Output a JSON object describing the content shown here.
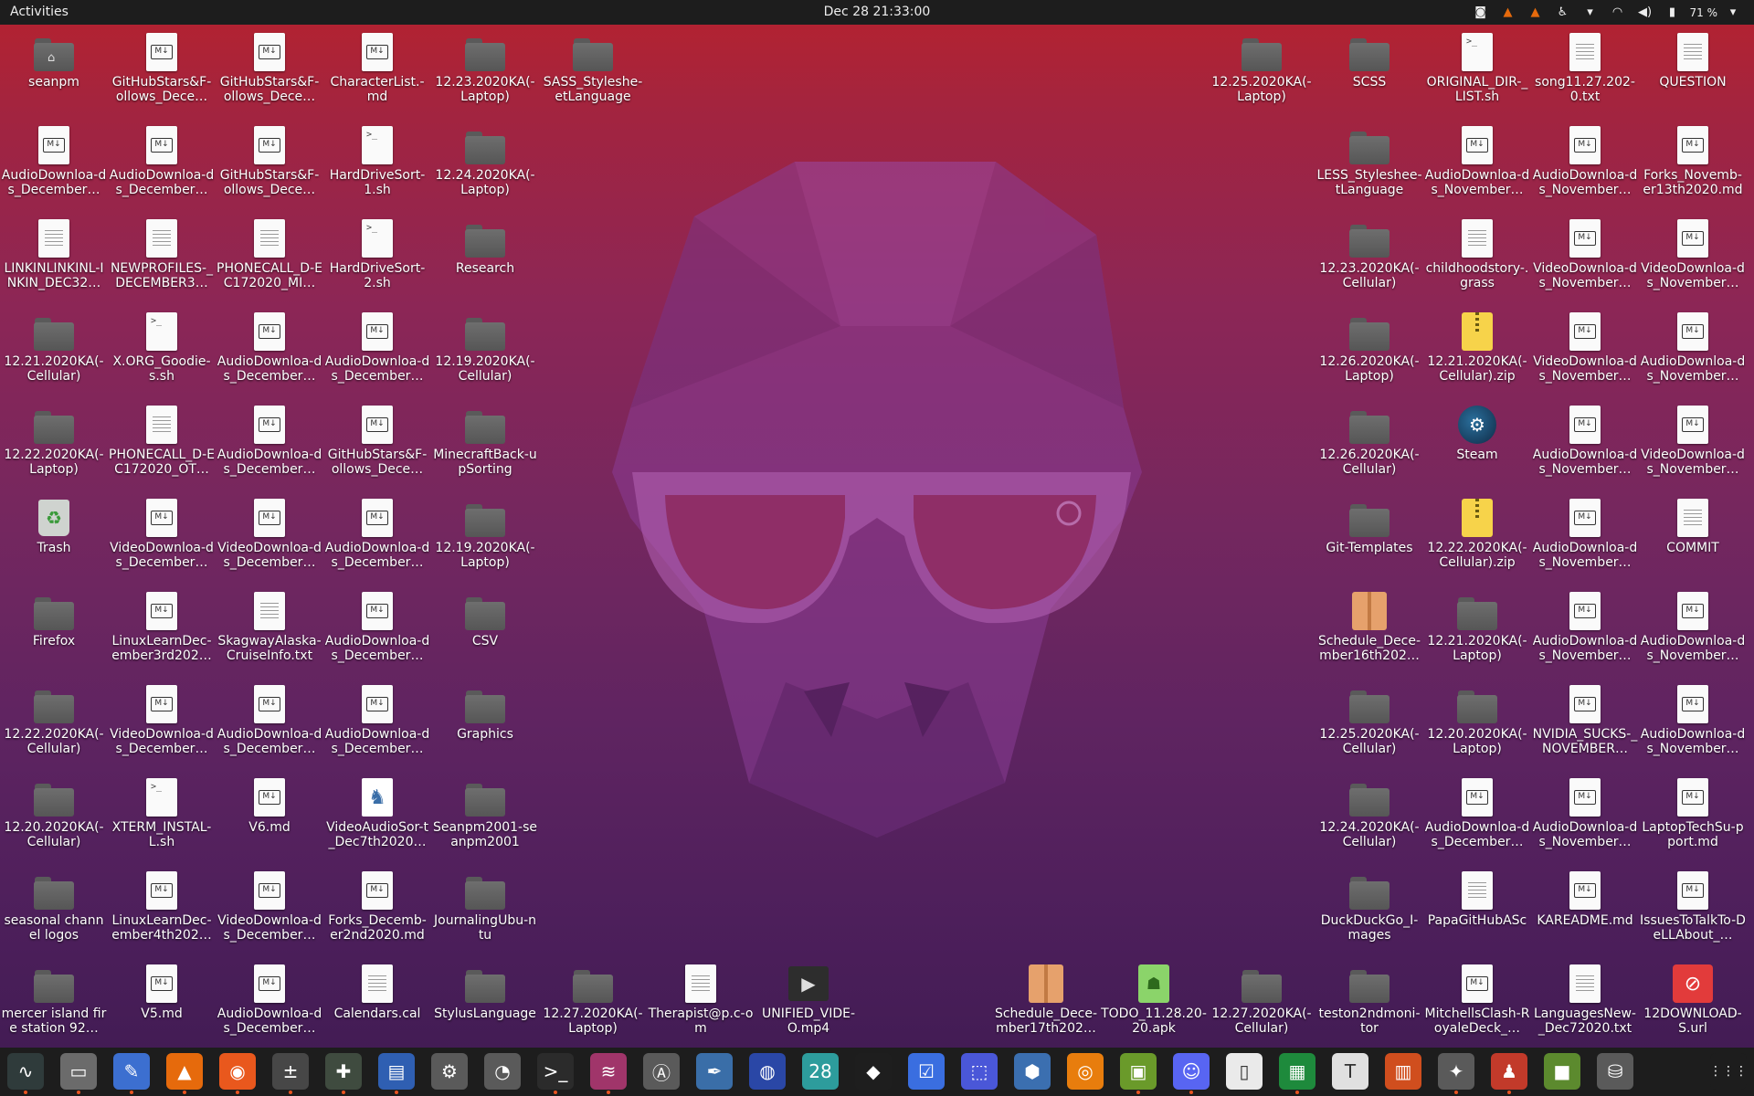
{
  "topbar": {
    "activities": "Activities",
    "clock": "Dec 28  21:33:00",
    "battery": "71 %",
    "tray_icons": [
      "discord-icon",
      "vlc-tray-icon",
      "vlc-tray-icon-2",
      "accessibility-icon",
      "chevron-down-icon",
      "wifi-icon",
      "volume-icon",
      "battery-icon"
    ]
  },
  "colors": {
    "panel": "#1d1d1d",
    "accent": "#e95420",
    "wall_top": "#b6222e",
    "wall_bottom": "#3f1b52"
  },
  "desktop": {
    "icons": [
      {
        "label": "seanpm",
        "type": "home"
      },
      {
        "label": "GitHubStars&F-ollows_Dece…",
        "type": "md"
      },
      {
        "label": "GitHubStars&F-ollows_Dece…",
        "type": "md"
      },
      {
        "label": "CharacterList.-md",
        "type": "md"
      },
      {
        "label": "12.23.2020KA(-Laptop)",
        "type": "folder"
      },
      {
        "label": "SASS_Styleshe-etLanguage",
        "type": "folder"
      },
      {
        "label": "AudioDownloa-ds_December…",
        "type": "md"
      },
      {
        "label": "AudioDownloa-ds_December…",
        "type": "md"
      },
      {
        "label": "GitHubStars&F-ollows_Dece…",
        "type": "md"
      },
      {
        "label": "HardDriveSort-1.sh",
        "type": "sh"
      },
      {
        "label": "12.24.2020KA(-Laptop)",
        "type": "folder"
      },
      {
        "label": "LINKINLINKINL-INKIN_DEC32…",
        "type": "txt"
      },
      {
        "label": "NEWPROFILES-_DECEMBER3…",
        "type": "txt"
      },
      {
        "label": "PHONECALL_D-EC172020_MI…",
        "type": "txt"
      },
      {
        "label": "HardDriveSort-2.sh",
        "type": "sh"
      },
      {
        "label": "Research",
        "type": "folder"
      },
      {
        "label": "12.21.2020KA(-Cellular)",
        "type": "folder"
      },
      {
        "label": "X.ORG_Goodie-s.sh",
        "type": "sh"
      },
      {
        "label": "AudioDownloa-ds_December…",
        "type": "md"
      },
      {
        "label": "AudioDownloa-ds_December…",
        "type": "md"
      },
      {
        "label": "12.19.2020KA(-Cellular)",
        "type": "folder"
      },
      {
        "label": "12.22.2020KA(-Laptop)",
        "type": "folder"
      },
      {
        "label": "PHONECALL_D-EC172020_OT…",
        "type": "txt"
      },
      {
        "label": "AudioDownloa-ds_December…",
        "type": "md"
      },
      {
        "label": "GitHubStars&F-ollows_Dece…",
        "type": "md"
      },
      {
        "label": "MinecraftBack-upSorting",
        "type": "folder"
      },
      {
        "label": "Trash",
        "type": "trash"
      },
      {
        "label": "VideoDownloa-ds_December…",
        "type": "md"
      },
      {
        "label": "VideoDownloa-ds_December…",
        "type": "md"
      },
      {
        "label": "AudioDownloa-ds_December…",
        "type": "md"
      },
      {
        "label": "12.19.2020KA(-Laptop)",
        "type": "folder"
      },
      {
        "label": "Firefox",
        "type": "folder"
      },
      {
        "label": "LinuxLearnDec-ember3rd202…",
        "type": "md"
      },
      {
        "label": "SkagwayAlaska-CruiseInfo.txt",
        "type": "txt"
      },
      {
        "label": "AudioDownloa-ds_December…",
        "type": "md"
      },
      {
        "label": "CSV",
        "type": "folder"
      },
      {
        "label": "12.22.2020KA(-Cellular)",
        "type": "folder"
      },
      {
        "label": "VideoDownloa-ds_December…",
        "type": "md"
      },
      {
        "label": "AudioDownloa-ds_December…",
        "type": "md"
      },
      {
        "label": "AudioDownloa-ds_December…",
        "type": "md"
      },
      {
        "label": "Graphics",
        "type": "folder"
      },
      {
        "label": "12.20.2020KA(-Cellular)",
        "type": "folder"
      },
      {
        "label": "XTERM_INSTAL-L.sh",
        "type": "sh"
      },
      {
        "label": "V6.md",
        "type": "md"
      },
      {
        "label": "VideoAudioSor-t_Dec7th2020…",
        "type": "gnu"
      },
      {
        "label": "Seanpm2001-seanpm2001",
        "type": "folder"
      },
      {
        "label": "seasonal channel logos",
        "type": "folder"
      },
      {
        "label": "LinuxLearnDec-ember4th202…",
        "type": "md"
      },
      {
        "label": "VideoDownloa-ds_December…",
        "type": "md"
      },
      {
        "label": "Forks_Decemb-er2nd2020.md",
        "type": "md"
      },
      {
        "label": "JournalingUbu-ntu",
        "type": "folder"
      },
      {
        "label": "mercer island fire station 92…",
        "type": "folder"
      },
      {
        "label": "V5.md",
        "type": "md"
      },
      {
        "label": "AudioDownloa-ds_December…",
        "type": "md"
      },
      {
        "label": "Calendars.cal",
        "type": "txt"
      },
      {
        "label": "StylusLanguage",
        "type": "folder"
      },
      {
        "label": "12.27.2020KA(-Laptop)",
        "type": "folder"
      },
      {
        "label": "Therapist@p.c-om",
        "type": "txt"
      },
      {
        "label": "UNIFIED_VIDE-O.mp4",
        "type": "video"
      },
      {
        "label": "Schedule_Dece-mber17th202…",
        "type": "pkg"
      },
      {
        "label": "TODO_11.28.20-20.apk",
        "type": "apk"
      },
      {
        "label": "12.27.2020KA(-Cellular)",
        "type": "folder"
      },
      {
        "label": "teston2ndmoni-tor",
        "type": "folder"
      },
      {
        "label": "MitchellsClash-RoyaleDeck_…",
        "type": "md"
      },
      {
        "label": "LanguagesNew-_Dec72020.txt",
        "type": "txt"
      },
      {
        "label": "12DOWNLOAD-S.url",
        "type": "url"
      },
      {
        "label": "12.25.2020KA(-Laptop)",
        "type": "folder"
      },
      {
        "label": "SCSS",
        "type": "folder"
      },
      {
        "label": "ORIGINAL_DIR-_LIST.sh",
        "type": "sh"
      },
      {
        "label": "song11.27.202-0.txt",
        "type": "txt"
      },
      {
        "label": "QUESTION",
        "type": "txt"
      },
      {
        "label": "LESS_Styleshee-tLanguage",
        "type": "folder"
      },
      {
        "label": "AudioDownloa-ds_November…",
        "type": "md"
      },
      {
        "label": "AudioDownloa-ds_November…",
        "type": "md"
      },
      {
        "label": "Forks_Novemb-er13th2020.md",
        "type": "md"
      },
      {
        "label": "12.23.2020KA(-Cellular)",
        "type": "folder"
      },
      {
        "label": "childhoodstory-.grass",
        "type": "txt"
      },
      {
        "label": "VideoDownloa-ds_November…",
        "type": "md"
      },
      {
        "label": "VideoDownloa-ds_November…",
        "type": "md"
      },
      {
        "label": "12.26.2020KA(-Laptop)",
        "type": "folder"
      },
      {
        "label": "12.21.2020KA(-Cellular).zip",
        "type": "zip"
      },
      {
        "label": "VideoDownloa-ds_November…",
        "type": "md"
      },
      {
        "label": "AudioDownloa-ds_November…",
        "type": "md"
      },
      {
        "label": "12.26.2020KA(-Cellular)",
        "type": "folder"
      },
      {
        "label": "Steam",
        "type": "steam"
      },
      {
        "label": "AudioDownloa-ds_November…",
        "type": "md"
      },
      {
        "label": "VideoDownloa-ds_November…",
        "type": "md"
      },
      {
        "label": "Git-Templates",
        "type": "folder"
      },
      {
        "label": "12.22.2020KA(-Cellular).zip",
        "type": "zip"
      },
      {
        "label": "AudioDownloa-ds_November…",
        "type": "md"
      },
      {
        "label": "COMMIT",
        "type": "txt"
      },
      {
        "label": "Schedule_Dece-mber16th202…",
        "type": "pkg"
      },
      {
        "label": "12.21.2020KA(-Laptop)",
        "type": "folder"
      },
      {
        "label": "AudioDownloa-ds_November…",
        "type": "md"
      },
      {
        "label": "AudioDownloa-ds_November…",
        "type": "md"
      },
      {
        "label": "12.25.2020KA(-Cellular)",
        "type": "folder"
      },
      {
        "label": "12.20.2020KA(-Laptop)",
        "type": "folder"
      },
      {
        "label": "NVIDIA_SUCKS-_NOVEMBER…",
        "type": "md"
      },
      {
        "label": "AudioDownloa-ds_November…",
        "type": "md"
      },
      {
        "label": "12.24.2020KA(-Cellular)",
        "type": "folder"
      },
      {
        "label": "AudioDownloa-ds_December…",
        "type": "md"
      },
      {
        "label": "AudioDownloa-ds_November…",
        "type": "md"
      },
      {
        "label": "LaptopTechSu-pport.md",
        "type": "md"
      },
      {
        "label": "DuckDuckGo_I-mages",
        "type": "folder"
      },
      {
        "label": "PapaGitHubASc",
        "type": "txt"
      },
      {
        "label": "KAREADME.md",
        "type": "md"
      },
      {
        "label": "IssuesToTalkTo-DeLLAbout_…",
        "type": "md"
      }
    ]
  },
  "dock": {
    "items": [
      {
        "name": "system-monitor-icon",
        "glyph": "∿",
        "color": "#2f3b3b"
      },
      {
        "name": "files-icon",
        "glyph": "▭",
        "color": "#6b6b6b"
      },
      {
        "name": "text-editor-icon",
        "glyph": "✎",
        "color": "#3c6fd0"
      },
      {
        "name": "vlc-icon",
        "glyph": "▲",
        "color": "#e66a0c"
      },
      {
        "name": "firefox-icon",
        "glyph": "◉",
        "color": "#e9581d"
      },
      {
        "name": "calculator-icon",
        "glyph": "±",
        "color": "#474747"
      },
      {
        "name": "extensions-icon",
        "glyph": "✚",
        "color": "#3f4b3f"
      },
      {
        "name": "document-viewer-icon",
        "glyph": "▤",
        "color": "#2f5fb2"
      },
      {
        "name": "settings-icon",
        "glyph": "⚙",
        "color": "#5a5a5a"
      },
      {
        "name": "disk-usage-icon",
        "glyph": "◔",
        "color": "#5a5a5a"
      },
      {
        "name": "terminal-icon",
        "glyph": ">_",
        "color": "#2b2b2b"
      },
      {
        "name": "audio-recorder-icon",
        "glyph": "≋",
        "color": "#a0356a"
      },
      {
        "name": "software-updater-icon",
        "glyph": "Ⓐ",
        "color": "#5a5a5a"
      },
      {
        "name": "image-editor-icon",
        "glyph": "✒",
        "color": "#3a6ea8"
      },
      {
        "name": "browser-icon",
        "glyph": "◍",
        "color": "#2a47a6"
      },
      {
        "name": "calendar-icon",
        "glyph": "28",
        "color": "#2d9c9c"
      },
      {
        "name": "inkscape-icon",
        "glyph": "◆",
        "color": "#1e1e1e"
      },
      {
        "name": "tasks-icon",
        "glyph": "☑",
        "color": "#3a6ee0"
      },
      {
        "name": "screenshot-icon",
        "glyph": "⬚",
        "color": "#4a57d8"
      },
      {
        "name": "virtualbox-icon",
        "glyph": "⬢",
        "color": "#3b6fb0"
      },
      {
        "name": "blender-icon",
        "glyph": "◎",
        "color": "#e87d0d"
      },
      {
        "name": "image-viewer-icon",
        "glyph": "▣",
        "color": "#6a9a2a"
      },
      {
        "name": "discord-dock-icon",
        "glyph": "☺",
        "color": "#5865f2"
      },
      {
        "name": "text-file-icon",
        "glyph": "▯",
        "color": "#eaeaea"
      },
      {
        "name": "spreadsheet-icon",
        "glyph": "▦",
        "color": "#1e8a3c"
      },
      {
        "name": "typora-icon",
        "glyph": "T",
        "color": "#e0e0e0"
      },
      {
        "name": "presentation-icon",
        "glyph": "▥",
        "color": "#d04e1e"
      },
      {
        "name": "game-icon",
        "glyph": "✦",
        "color": "#5a5a5a"
      },
      {
        "name": "supertux-icon",
        "glyph": "♟",
        "color": "#c23a2a"
      },
      {
        "name": "minecraft-icon",
        "glyph": "■",
        "color": "#5c8a2e"
      },
      {
        "name": "usb-creator-icon",
        "glyph": "⛁",
        "color": "#5a5a5a"
      },
      {
        "name": "show-apps-icon",
        "glyph": "⋮⋮⋮",
        "color": "#1d1d1d"
      }
    ]
  }
}
